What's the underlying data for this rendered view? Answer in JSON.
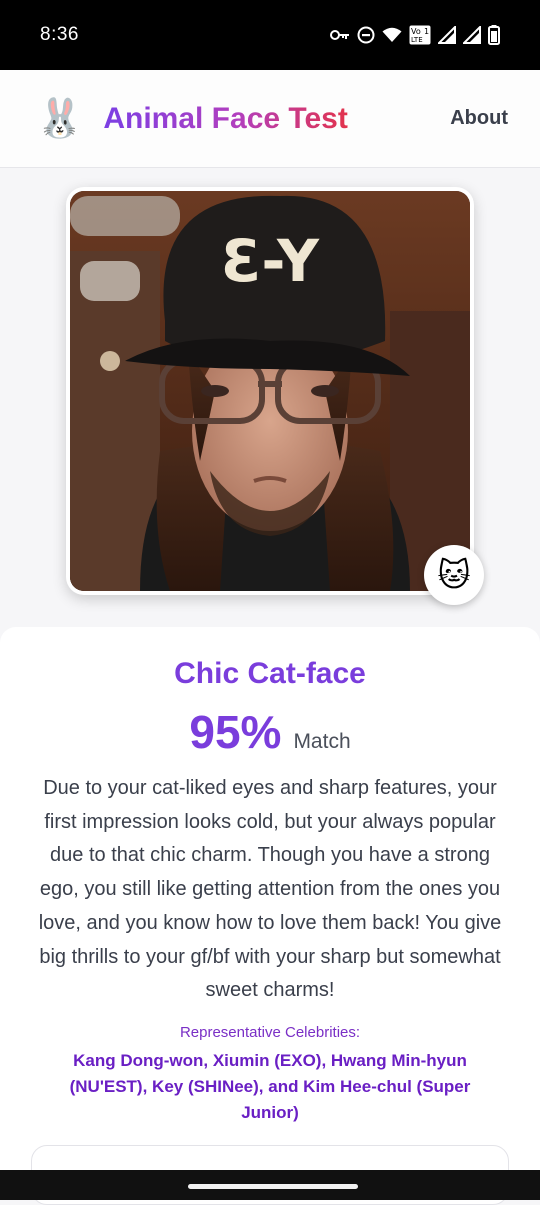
{
  "status_bar": {
    "time": "8:36",
    "icons": [
      "key-icon",
      "do-not-disturb-icon",
      "wifi-icon",
      "volte-icon",
      "signal-icon",
      "signal-icon",
      "battery-icon"
    ],
    "volte_label": "Vo LTE 1"
  },
  "header": {
    "logo_emoji": "🐰",
    "title": "Animal Face Test",
    "about_label": "About"
  },
  "photo": {
    "cap_text": "Ɛ-Y",
    "badge_emoji": "🐱"
  },
  "result": {
    "title": "Chic Cat-face",
    "percent": "95%",
    "match_label": "Match",
    "description": "Due to your cat-liked eyes and sharp features, your first impression looks cold, but your always popular due to that chic charm. Though you have a strong ego, you still like getting attention from the ones you love, and you know how to love them back! You give big thrills to your gf/bf with your sharp but somewhat sweet charms!",
    "celebrities_heading": "Representative Celebrities:",
    "celebrities": "Kang Dong-won, Xiumin (EXO), Hwang Min-hyun (NU'EST), Key (SHINee), and Kim Hee-chul (Super Junior)"
  },
  "colors": {
    "accent_purple": "#7a3ddc",
    "gradient_start": "#7b3fe4",
    "gradient_end": "#e2334c"
  }
}
